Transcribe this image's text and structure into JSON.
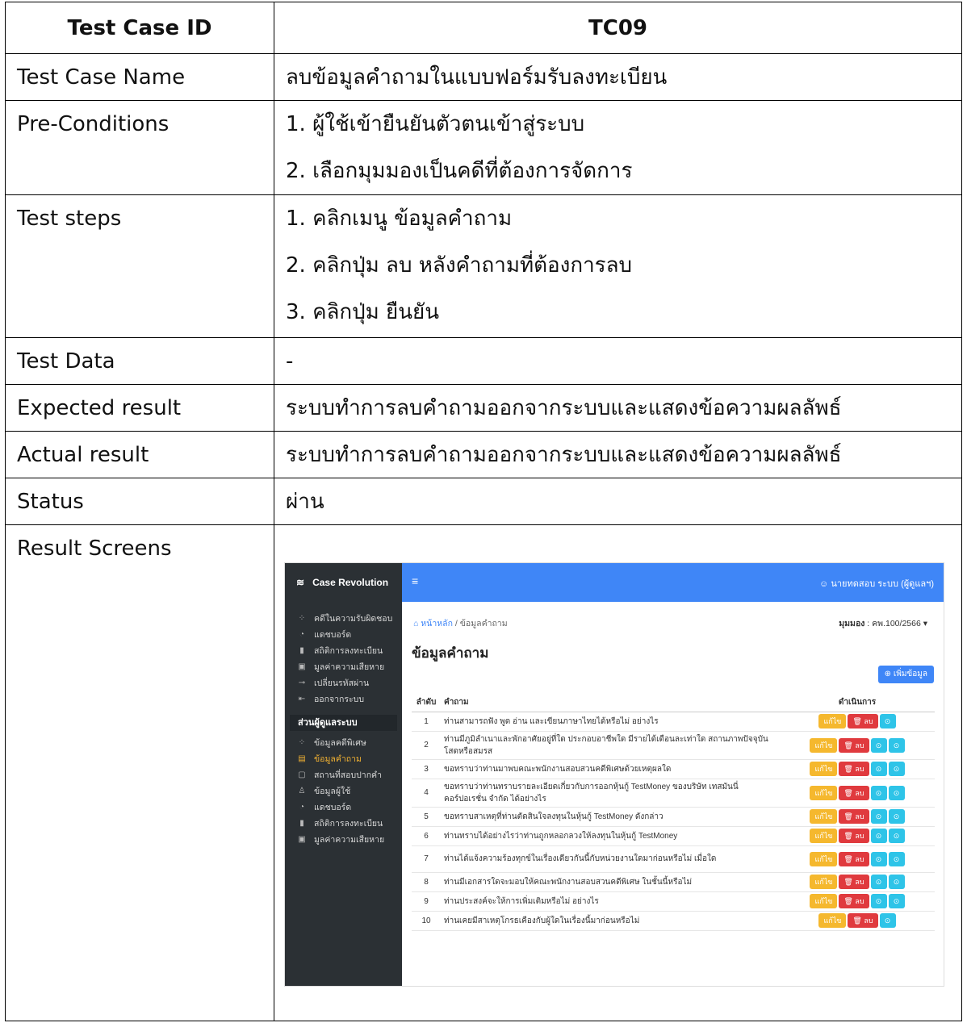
{
  "table": {
    "header": {
      "label": "Test Case ID",
      "value": "TC09"
    },
    "name": {
      "label": "Test Case Name",
      "value": "ลบข้อมูลคำถามในแบบฟอร์มรับลงทะเบียน"
    },
    "preconditions": {
      "label": "Pre-Conditions",
      "items": [
        "1. ผู้ใช้เข้ายืนยันตัวตนเข้าสู่ระบบ",
        "2. เลือกมุมมองเป็นคดีที่ต้องการจัดการ"
      ]
    },
    "steps": {
      "label": "Test steps",
      "items": [
        "1. คลิกเมนู ข้อมูลคำถาม",
        "2. คลิกปุ่ม ลบ หลังคำถามที่ต้องการลบ",
        "3. คลิกปุ่ม ยืนยัน"
      ]
    },
    "data": {
      "label": "Test Data",
      "value": "-"
    },
    "expected": {
      "label": "Expected result",
      "value": "ระบบทำการลบคำถามออกจากระบบและแสดงข้อความผลลัพธ์"
    },
    "actual": {
      "label": "Actual result",
      "value": "ระบบทำการลบคำถามออกจากระบบและแสดงข้อความผลลัพธ์"
    },
    "status": {
      "label": "Status",
      "value": "ผ่าน"
    },
    "screens": {
      "label": "Result Screens"
    }
  },
  "screenshot": {
    "brand": "Case Revolution",
    "nav": [
      {
        "icon": "grid-icon",
        "glyph": "⁘",
        "label": "คดีในความรับผิดชอบ"
      },
      {
        "icon": "dashboard-icon",
        "glyph": "◔",
        "label": "แดชบอร์ด"
      },
      {
        "icon": "stats-icon",
        "glyph": "▮",
        "label": "สถิติการลงทะเบียน"
      },
      {
        "icon": "damage-icon",
        "glyph": "▣",
        "label": "มูลค่าความเสียหาย"
      },
      {
        "icon": "key-icon",
        "glyph": "⊸",
        "label": "เปลี่ยนรหัสผ่าน"
      },
      {
        "icon": "logout-icon",
        "glyph": "⇤",
        "label": "ออกจากระบบ"
      }
    ],
    "section": "ส่วนผู้ดูแลระบบ",
    "admin_nav": [
      {
        "icon": "grid-icon",
        "glyph": "⁘",
        "label": "ข้อมูลคดีพิเศษ",
        "active": false
      },
      {
        "icon": "question-icon",
        "glyph": "▤",
        "label": "ข้อมูลคำถาม",
        "active": true
      },
      {
        "icon": "form-icon",
        "glyph": "▢",
        "label": "สถานที่สอบปากคำ",
        "active": false
      },
      {
        "icon": "user-icon",
        "glyph": "♙",
        "label": "ข้อมูลผู้ใช้",
        "active": false
      },
      {
        "icon": "dashboard-icon",
        "glyph": "◔",
        "label": "แดชบอร์ด",
        "active": false
      },
      {
        "icon": "stats-icon",
        "glyph": "▮",
        "label": "สถิติการลงทะเบียน",
        "active": false
      },
      {
        "icon": "damage-icon",
        "glyph": "▣",
        "label": "มูลค่าความเสียหาย",
        "active": false
      }
    ],
    "menu_glyph": "≡",
    "user": "☺ นายทดสอบ ระบบ (ผู้ดูแลฯ)",
    "breadcrumb": {
      "home": "⌂ หน้าหลัก",
      "sep": " / ",
      "current": "ข้อมูลคำถาม"
    },
    "perspective": {
      "label": "มุมมอง",
      "value": " : คพ.100/2566 ▾"
    },
    "title": "ข้อมูลคำถาม",
    "add_button": "⊕ เพิ่มข้อมูล",
    "columns": {
      "no": "ลำดับ",
      "question": "คำถาม",
      "action": "ดำเนินการ"
    },
    "buttons": {
      "edit": "แก้ไข",
      "delete": "🗑 ลบ",
      "up": "⊙",
      "down": "⊙"
    },
    "rows": [
      {
        "no": "1",
        "q": "ท่านสามารถฟัง พูด อ่าน และเขียนภาษาไทยได้หรือไม่ อย่างไร",
        "up": false,
        "down": true
      },
      {
        "no": "2",
        "q": "ท่านมีภูมิลำเนาและพักอาศัยอยู่ที่ใด ประกอบอาชีพใด มีรายได้เดือนละเท่าใด สถานภาพปัจจุบัน โสดหรือสมรส",
        "up": true,
        "down": true
      },
      {
        "no": "3",
        "q": "ขอทราบว่าท่านมาพบคณะพนักงานสอบสวนคดีพิเศษด้วยเหตุผลใด",
        "up": true,
        "down": true
      },
      {
        "no": "4",
        "q": "ขอทราบว่าท่านทราบรายละเอียดเกี่ยวกับการออกหุ้นกู้ TestMoney ของบริษัท เทสมันนี่ คอร์ปอเรชั่น จำกัด ได้อย่างไร",
        "up": true,
        "down": true
      },
      {
        "no": "5",
        "q": "ขอทราบสาเหตุที่ท่านตัดสินใจลงทุนในหุ้นกู้ TestMoney ดังกล่าว",
        "up": true,
        "down": true
      },
      {
        "no": "6",
        "q": "ท่านทราบได้อย่างไรว่าท่านถูกหลอกลวงให้ลงทุนในหุ้นกู้ TestMoney",
        "up": true,
        "down": true
      },
      {
        "no": "7",
        "q": "ท่านได้แจ้งความร้องทุกข์ในเรื่องเดียวกันนี้กับหน่วยงานใดมาก่อนหรือไม่ เมื่อใด",
        "up": true,
        "down": true
      },
      {
        "no": "8",
        "q": "ท่านมีเอกสารใดจะมอบให้คณะพนักงานสอบสวนคดีพิเศษ ในชั้นนี้หรือไม่",
        "up": true,
        "down": true
      },
      {
        "no": "9",
        "q": "ท่านประสงค์จะให้การเพิ่มเติมหรือไม่ อย่างไร",
        "up": true,
        "down": true
      },
      {
        "no": "10",
        "q": "ท่านเคยมีสาเหตุโกรธเคืองกับผู้ใดในเรื่องนี้มาก่อนหรือไม่",
        "up": true,
        "down": false
      }
    ]
  }
}
